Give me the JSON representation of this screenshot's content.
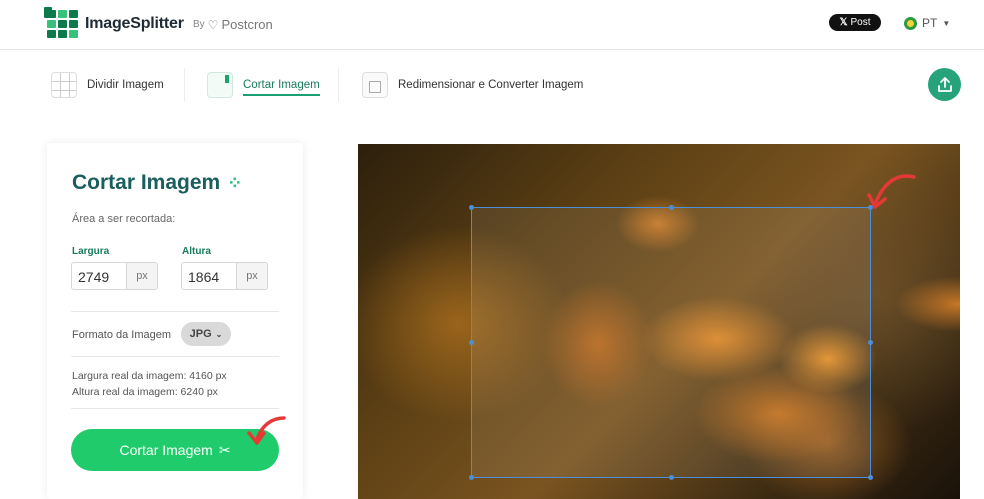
{
  "header": {
    "brand": "ImageSplitter",
    "by_label": "By",
    "partner": "Postcron",
    "share_label": "Post",
    "language": "PT"
  },
  "tabs": [
    {
      "label": "Dividir Imagem",
      "icon": "grid-icon",
      "active": false
    },
    {
      "label": "Cortar Imagem",
      "icon": "crop-icon",
      "active": true
    },
    {
      "label": "Redimensionar e Converter Imagem",
      "icon": "resize-icon",
      "active": false
    }
  ],
  "panel": {
    "title": "Cortar Imagem",
    "area_label": "Área a ser recortada:",
    "width_label": "Largura",
    "width_value": "2749",
    "height_label": "Altura",
    "height_value": "1864",
    "unit": "px",
    "format_label": "Formato da Imagem",
    "format_value": "JPG",
    "real_width": "Largura real da imagem: 4160 px",
    "real_height": "Altura real da imagem: 6240 px",
    "crop_button": "Cortar Imagem"
  },
  "colors": {
    "accent": "#1a7a5e",
    "button": "#1fcb6b",
    "crop_border": "#4a8fd8",
    "annotation": "#e53935"
  }
}
